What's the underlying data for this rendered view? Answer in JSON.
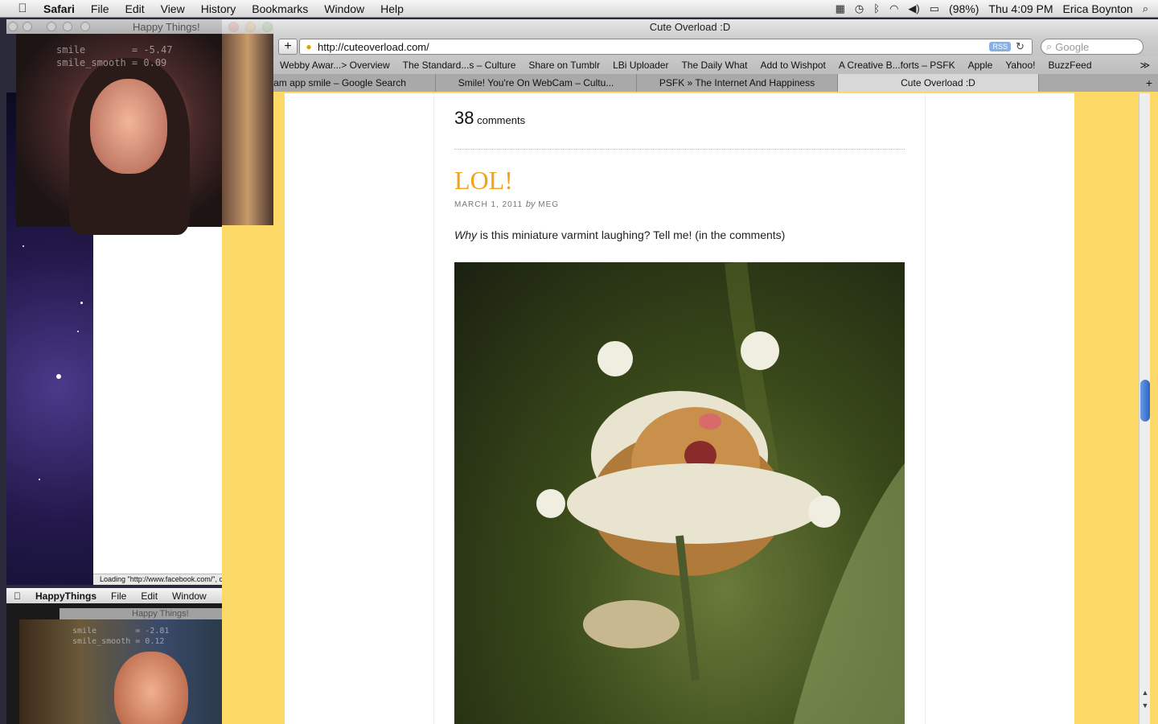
{
  "menubar": {
    "app": "Safari",
    "items": [
      "File",
      "Edit",
      "View",
      "History",
      "Bookmarks",
      "Window",
      "Help"
    ],
    "battery": "(98%)",
    "clock": "Thu 4:09 PM",
    "user": "Erica Boynton"
  },
  "cam_window1": {
    "title": "Happy Things!",
    "overlay": "smile        = -5.47\nsmile_smooth = 0.09"
  },
  "cam_app": {
    "app": "HappyThings",
    "items": [
      "File",
      "Edit",
      "Window"
    ],
    "title": "Happy Things!",
    "overlay": "smile        = -2.81\nsmile_smooth = 0.12"
  },
  "desktop": {
    "status": "Loading \"http://www.facebook.com/\", c"
  },
  "safari": {
    "window_title": "Cute Overload :D",
    "url": "http://cuteoverload.com/",
    "rss": "RSS",
    "search_placeholder": "Google",
    "bookmarks": [
      "Webby Awar...> Overview",
      "The Standard...s – Culture",
      "Share on Tumblr",
      "LBi Uploader",
      "The Daily What",
      "Add to Wishpot",
      "A Creative B...forts – PSFK",
      "Apple",
      "Yahoo!",
      "BuzzFeed"
    ],
    "tabs": [
      {
        "label": "webcam app smile – Google Search",
        "active": false
      },
      {
        "label": "Smile! You're On WebCam – Cultu...",
        "active": false
      },
      {
        "label": "PSFK » The Internet And Happiness",
        "active": false
      },
      {
        "label": "Cute Overload :D",
        "active": true
      }
    ]
  },
  "post": {
    "comments_count": "38",
    "comments_label": "comments",
    "title": "LOL!",
    "date": "MARCH 1, 2011",
    "by": "by",
    "author": "MEG",
    "body_em": "Why",
    "body_rest": " is this miniature varmint laughing? Tell me! (in the comments)"
  },
  "colors": {
    "accent_title": "#f4a21c",
    "page_bg": "#fdd968"
  }
}
